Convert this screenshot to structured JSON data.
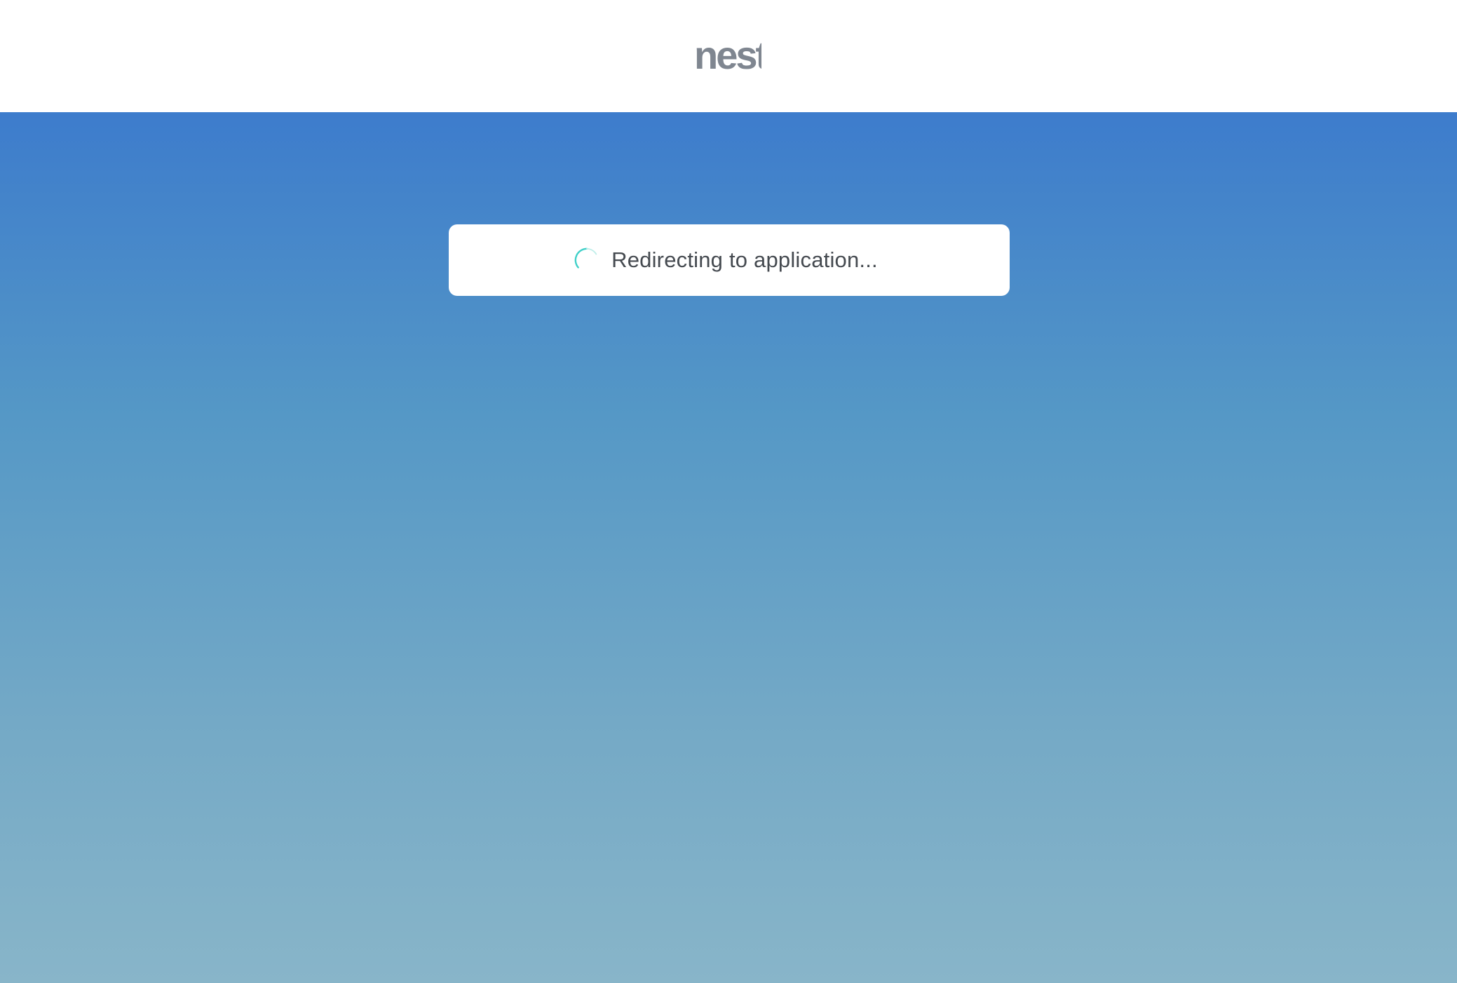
{
  "header": {
    "logo_text": "nest",
    "logo_color": "#7f8690"
  },
  "status": {
    "message": "Redirecting to application...",
    "spinner_color": "#3fd0c8"
  },
  "background": {
    "gradient_top": "#3d7ccc",
    "gradient_bottom": "#88b5c9"
  }
}
